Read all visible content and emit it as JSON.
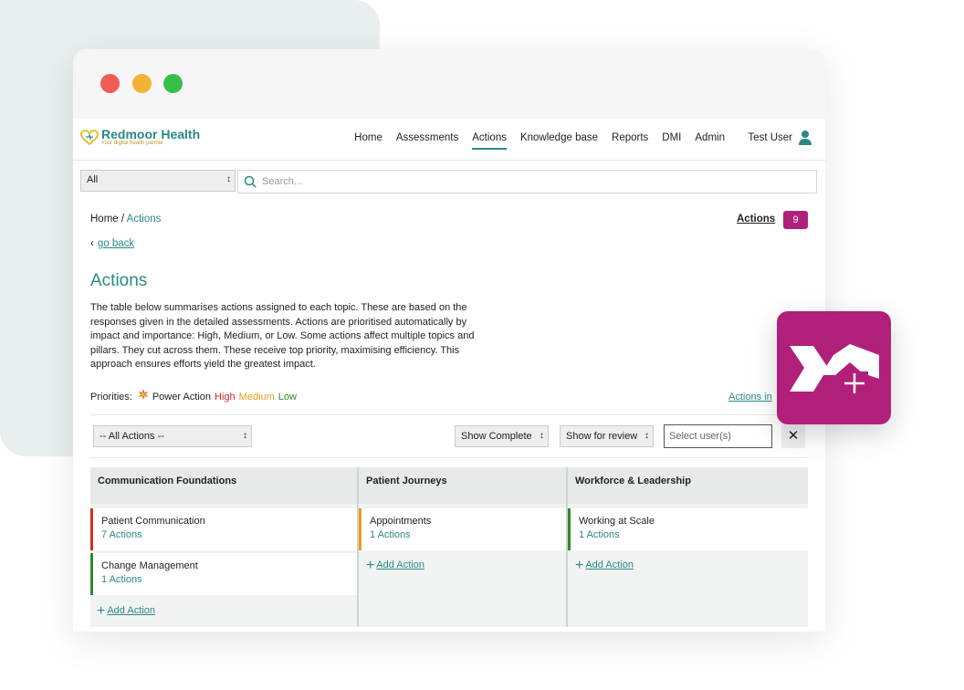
{
  "brand": {
    "name": "Redmoor Health",
    "tagline": "Your digital health partner"
  },
  "nav": {
    "items": [
      "Home",
      "Assessments",
      "Actions",
      "Knowledge base",
      "Reports",
      "DMI",
      "Admin"
    ],
    "active_index": 2,
    "user": "Test User"
  },
  "search": {
    "scope": "All",
    "placeholder": "Search..."
  },
  "breadcrumb": {
    "home": "Home",
    "current": "Actions"
  },
  "header_link": {
    "label": "Actions",
    "count": "9"
  },
  "go_back": "go back",
  "page_title": "Actions",
  "description": "The table below summarises actions assigned to each topic. These are based on the responses given in the detailed assessments. Actions are prioritised automatically by impact and importance: High, Medium, or Low. Some actions affect multiple topics and pillars. They cut across them. These receive top priority, maximising efficiency. This approach ensures efforts yield the greatest impact.",
  "priorities": {
    "label": "Priorities:",
    "power": "Power Action",
    "high": "High",
    "medium": "Medium",
    "low": "Low"
  },
  "actions_in_link": "Actions in",
  "filters": {
    "all_actions": "-- All Actions --",
    "show_complete": "Show Complete",
    "show_review": "Show for review",
    "user_placeholder": "Select user(s)",
    "close": "✕"
  },
  "columns": [
    {
      "title": "Communication Foundations",
      "cards": [
        {
          "name": "Patient Communication",
          "count": "7 Actions"
        },
        {
          "name": "Change Management",
          "count": "1 Actions"
        }
      ],
      "add": "Add Action"
    },
    {
      "title": "Patient Journeys",
      "cards": [
        {
          "name": "Appointments",
          "count": "1 Actions"
        }
      ],
      "add": "Add Action"
    },
    {
      "title": "Workforce & Leadership",
      "cards": [
        {
          "name": "Working at Scale",
          "count": "1 Actions"
        }
      ],
      "add": "Add Action"
    }
  ],
  "colors": {
    "brand_teal": "#2a8a86",
    "accent_magenta": "#b0207a",
    "high": "#d22b2b",
    "medium": "#e89a1c",
    "low": "#2b8a32"
  }
}
